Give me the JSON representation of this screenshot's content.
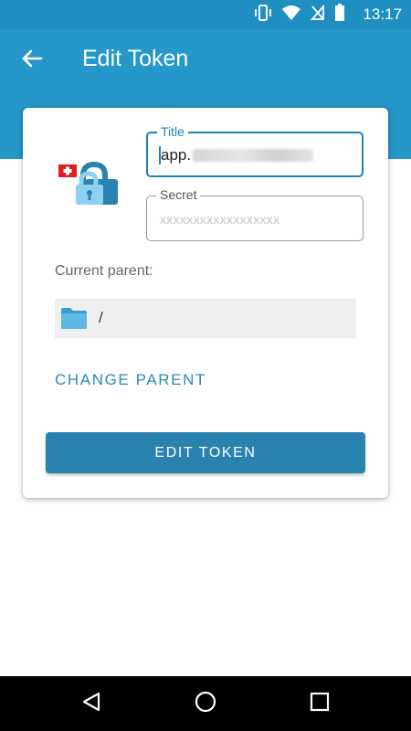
{
  "status_bar": {
    "time": "13:17",
    "icons": [
      "vibrate-icon",
      "wifi-icon",
      "no-sim-icon",
      "battery-icon"
    ]
  },
  "app_bar": {
    "title": "Edit Token",
    "back_icon": "arrow-back-icon"
  },
  "form": {
    "token_icon": "swiss-lock-token-icon",
    "title_field": {
      "label": "Title",
      "value": "app."
    },
    "secret_field": {
      "label": "Secret",
      "placeholder": "xxxxxxxxxxxxxxxxxx"
    },
    "current_parent_label": "Current parent:",
    "current_parent_path": "/",
    "folder_icon": "folder-icon",
    "change_parent_label": "CHANGE PARENT",
    "edit_button_label": "EDIT TOKEN"
  },
  "nav_bar": {
    "icons": [
      "back-triangle-icon",
      "home-circle-icon",
      "recents-square-icon"
    ]
  },
  "colors": {
    "primary": "#2597c9",
    "status_bar": "#1f8fc1",
    "accent": "#1b84b5",
    "button": "#2a82b0"
  }
}
